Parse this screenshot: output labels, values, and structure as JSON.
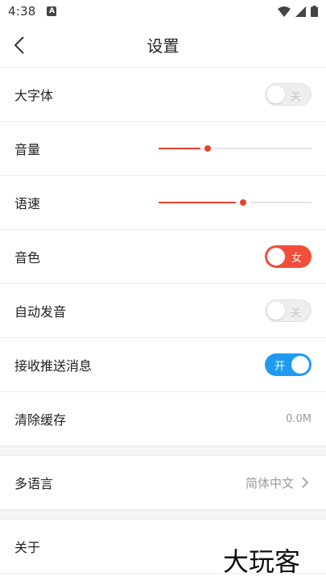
{
  "status": {
    "time": "4:38",
    "sim_badge": "A"
  },
  "header": {
    "title": "设置"
  },
  "settings": {
    "large_font": {
      "label": "大字体",
      "toggle_text": "关",
      "on": false
    },
    "volume": {
      "label": "音量",
      "level": 0.32
    },
    "speed": {
      "label": "语速",
      "level": 0.55
    },
    "voice": {
      "label": "音色",
      "toggle_text": "女"
    },
    "auto_pronounce": {
      "label": "自动发音",
      "toggle_text": "关",
      "on": false
    },
    "push": {
      "label": "接收推送消息",
      "toggle_text": "开",
      "on": true
    },
    "cache": {
      "label": "清除缓存",
      "value": "0.0M"
    },
    "language": {
      "label": "多语言",
      "value": "简体中文"
    },
    "about": {
      "label": "关于"
    }
  },
  "colors": {
    "accent": "#e8412c",
    "toggle_red": "#f04f3b",
    "toggle_blue": "#1e9bf0"
  },
  "watermark": {
    "text": "大玩客"
  }
}
